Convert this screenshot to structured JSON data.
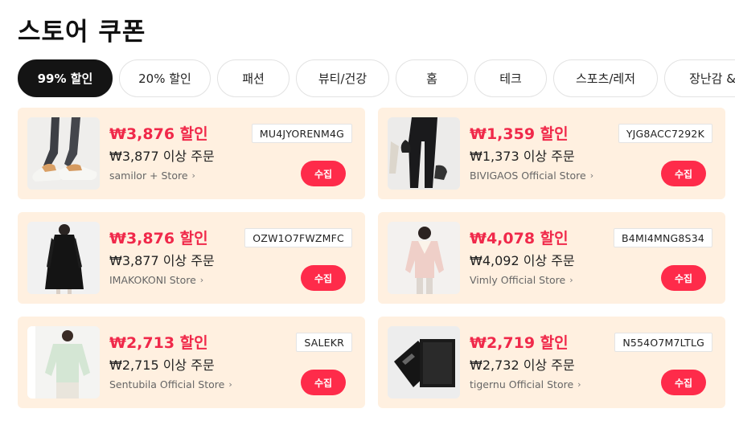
{
  "page": {
    "title": "스토어 쿠폰"
  },
  "tabs": [
    {
      "label": "99% 할인",
      "active": true
    },
    {
      "label": "20% 할인"
    },
    {
      "label": "패션"
    },
    {
      "label": "뷰티/건강"
    },
    {
      "label": "홈"
    },
    {
      "label": "테크"
    },
    {
      "label": "스포츠/레저"
    },
    {
      "label": "장난감 &"
    }
  ],
  "coupons": [
    {
      "discount": "₩3,876 할인",
      "min_order": "₩3,877 이상 주문",
      "store": "samilor + Store",
      "code": "MU4JYORENM4G",
      "claim": "수집",
      "image": "slippers-photo"
    },
    {
      "discount": "₩1,359 할인",
      "min_order": "₩1,373 이상 주문",
      "store": "BIVIGAOS Official Store",
      "code": "YJG8ACC7292K",
      "claim": "수집",
      "image": "leggings-photo"
    },
    {
      "discount": "₩3,876 할인",
      "min_order": "₩3,877 이상 주문",
      "store": "IMAKOKONI Store",
      "code": "OZW1O7FWZMFC",
      "claim": "수집",
      "image": "black-coat-photo"
    },
    {
      "discount": "₩4,078 할인",
      "min_order": "₩4,092 이상 주문",
      "store": "Vimly Official Store",
      "code": "B4MI4MNG8S34",
      "claim": "수집",
      "image": "pink-jacket-photo"
    },
    {
      "discount": "₩2,713 할인",
      "min_order": "₩2,715 이상 주문",
      "store": "Sentubila Official Store",
      "code": "SALEKR",
      "claim": "수집",
      "image": "sweatshirt-photo"
    },
    {
      "discount": "₩2,719 할인",
      "min_order": "₩2,732 이상 주문",
      "store": "tigernu Official Store",
      "code": "N554O7M7LTLG",
      "claim": "수집",
      "image": "wallet-photo"
    }
  ]
}
